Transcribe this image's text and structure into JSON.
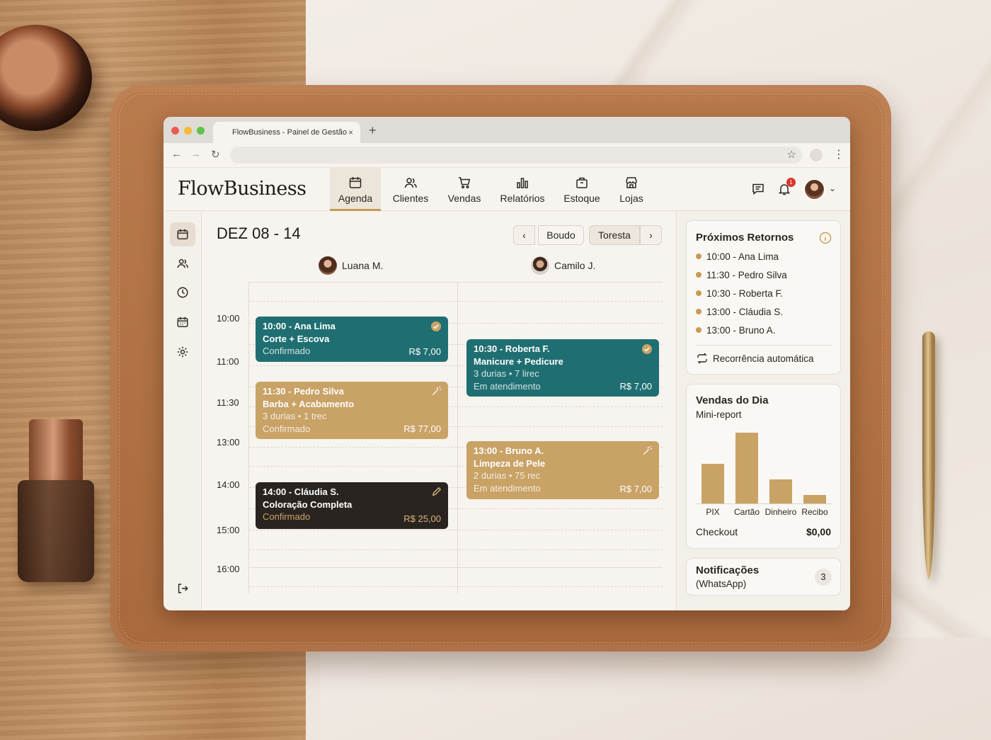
{
  "browser": {
    "tab_title": "FlowBusiness - Painel de Gestão",
    "tab_close": "×",
    "new_tab": "+",
    "url": ""
  },
  "app": {
    "brand": "FlowBusiness",
    "nav": [
      {
        "label": "Agenda",
        "icon": "calendar-icon",
        "active": true
      },
      {
        "label": "Clientes",
        "icon": "users-icon"
      },
      {
        "label": "Vendas",
        "icon": "cart-icon"
      },
      {
        "label": "Relatórios",
        "icon": "bar-chart-icon"
      },
      {
        "label": "Estoque",
        "icon": "package-icon"
      },
      {
        "label": "Lojas",
        "icon": "store-icon"
      }
    ],
    "notifications_count": "1",
    "accent": "#c79a55"
  },
  "calendar": {
    "range": "DEZ 08 - 14",
    "prev": "‹",
    "next": "›",
    "view_options": [
      "Boudo",
      "Toresta"
    ],
    "staff": [
      {
        "name": "Luana M."
      },
      {
        "name": "Camilo J."
      }
    ],
    "times": [
      "10:00",
      "11:00",
      "11:30",
      "13:00",
      "14:00",
      "15:00",
      "16:00"
    ],
    "appointments": [
      {
        "title": "10:00 - Ana Lima",
        "service": "Corte + Escova",
        "details": "",
        "status": "Confirmado",
        "price": "R$ 7,00",
        "color": "#1f6f72",
        "icon": "check-circle-icon"
      },
      {
        "title": "11:30 - Pedro Silva",
        "service": "Barba + Acabamento",
        "details": "3 durias • 1 trec",
        "status": "Confirmado",
        "price": "R$ 77,00",
        "color": "#c9a266",
        "icon": "magic-wand-icon"
      },
      {
        "title": "14:00 - Cláudia S.",
        "service": "Coloração Completa",
        "details": "",
        "status": "Confirmado",
        "price": "R$ 25,00",
        "color": "#2a2420",
        "icon": "pencil-icon"
      },
      {
        "title": "10:30 - Roberta F.",
        "service": "Manicure + Pedicure",
        "details": "3 durias • 7 lirec",
        "status": "Em atendimento",
        "price": "R$ 7,00",
        "color": "#1f6f72",
        "icon": "check-circle-icon"
      },
      {
        "title": "13:00 - Bruno A.",
        "service": "Limpeza de Pele",
        "details": "2 durias • 75 rec",
        "status": "Em atendimento",
        "price": "R$ 7,00",
        "color": "#c9a266",
        "icon": "magic-wand-icon"
      }
    ]
  },
  "returns": {
    "title": "Próximos Retornos",
    "items": [
      "10:00 - Ana Lima",
      "11:30 - Pedro Silva",
      "10:30 - Roberta F.",
      "13:00 - Cláudia S.",
      "13:00 - Bruno A."
    ],
    "recurrence": "Recorrência automática"
  },
  "sales": {
    "title": "Vendas do Dia",
    "subtitle": "Mini-report",
    "checkout_label": "Checkout",
    "checkout_value": "$0,00"
  },
  "chart_data": {
    "type": "bar",
    "categories": [
      "PIX",
      "Cartão",
      "Dinheiro",
      "Recibo"
    ],
    "values": [
      56,
      100,
      34,
      12
    ],
    "title": "",
    "xlabel": "",
    "ylabel": "",
    "ylim": [
      0,
      100
    ],
    "grid": false
  },
  "notifications": {
    "title": "Notificações",
    "subtitle": "(WhatsApp)",
    "count": "3"
  }
}
